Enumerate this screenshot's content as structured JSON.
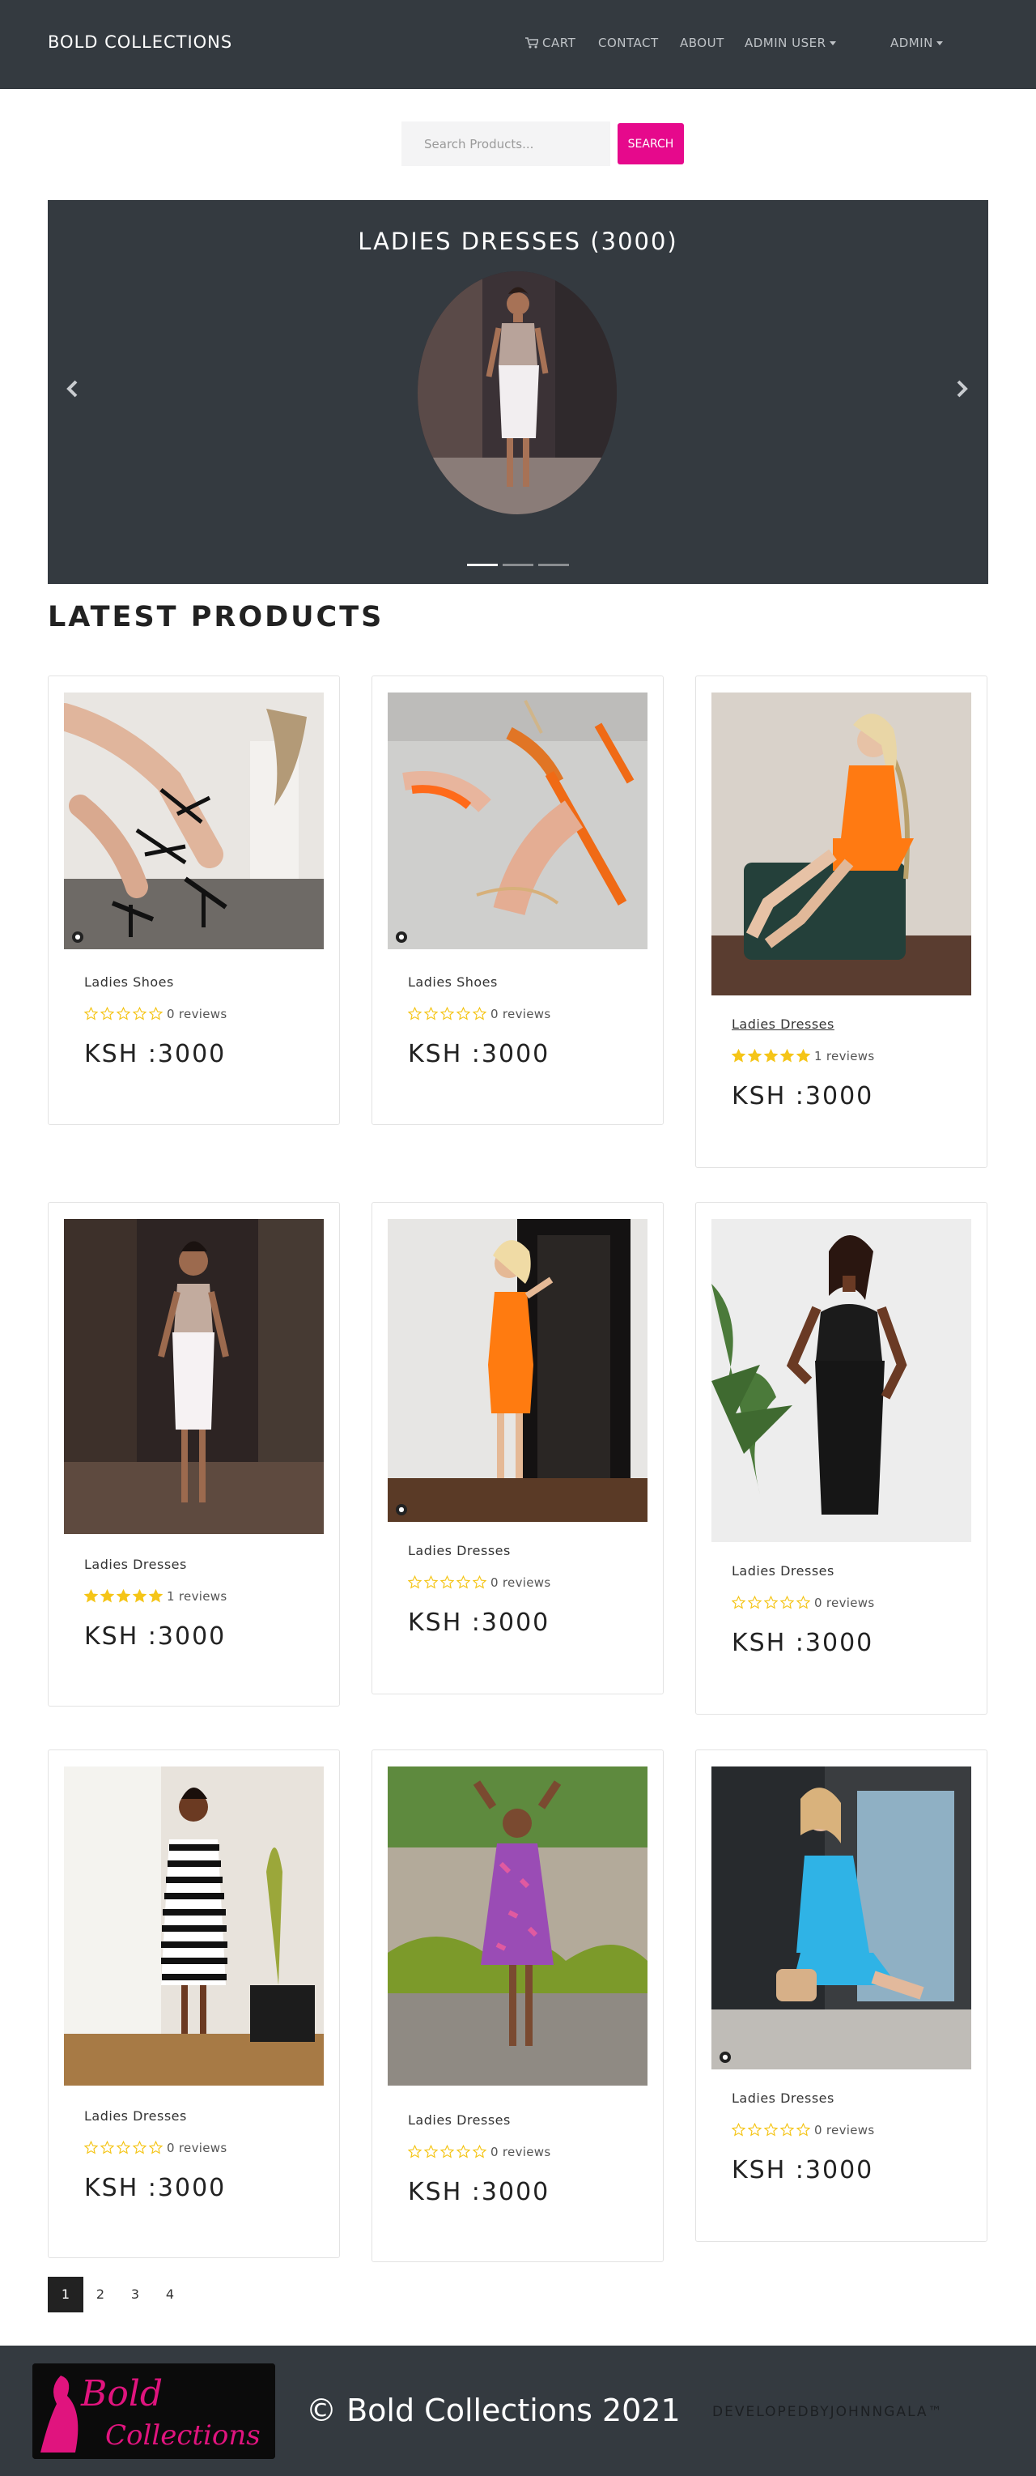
{
  "navbar": {
    "brand": "BOLD COLLECTIONS",
    "cart": "CART",
    "contact": "CONTACT",
    "about": "ABOUT",
    "admin_user": "ADMIN USER",
    "admin": "ADMIN"
  },
  "search": {
    "placeholder": "Search Products...",
    "button": "SEARCH"
  },
  "carousel": {
    "title": "LADIES DRESSES (3000)",
    "slide_count": 3,
    "active_slide": 1
  },
  "section": {
    "title": "LATEST PRODUCTS"
  },
  "products": [
    {
      "category": "Ladies Shoes",
      "rating": 0,
      "reviews": "0 reviews",
      "price": "KSH :3000"
    },
    {
      "category": "Ladies Shoes",
      "rating": 0,
      "reviews": "0 reviews",
      "price": "KSH :3000"
    },
    {
      "category": "Ladies Dresses",
      "rating": 5,
      "reviews": "1 reviews",
      "price": "KSH :3000"
    },
    {
      "category": "Ladies Dresses",
      "rating": 5,
      "reviews": "1 reviews",
      "price": "KSH :3000"
    },
    {
      "category": "Ladies Dresses",
      "rating": 0,
      "reviews": "0 reviews",
      "price": "KSH :3000"
    },
    {
      "category": "Ladies Dresses",
      "rating": 0,
      "reviews": "0 reviews",
      "price": "KSH :3000"
    },
    {
      "category": "Ladies Dresses",
      "rating": 0,
      "reviews": "0 reviews",
      "price": "KSH :3000"
    },
    {
      "category": "Ladies Dresses",
      "rating": 0,
      "reviews": "0 reviews",
      "price": "KSH :3000"
    },
    {
      "category": "Ladies Dresses",
      "rating": 0,
      "reviews": "0 reviews",
      "price": "KSH :3000"
    }
  ],
  "pagination": {
    "pages": [
      "1",
      "2",
      "3",
      "4"
    ],
    "active": "1"
  },
  "footer": {
    "logo_text_1": "Bold",
    "logo_text_2": "Collections",
    "copyright": "© Bold Collections 2021",
    "developer": "DEVELOPEDBYJOHNNGALA™"
  },
  "colors": {
    "navbar": "#343a40",
    "accent": "#e6098c",
    "star": "#f5c518"
  }
}
